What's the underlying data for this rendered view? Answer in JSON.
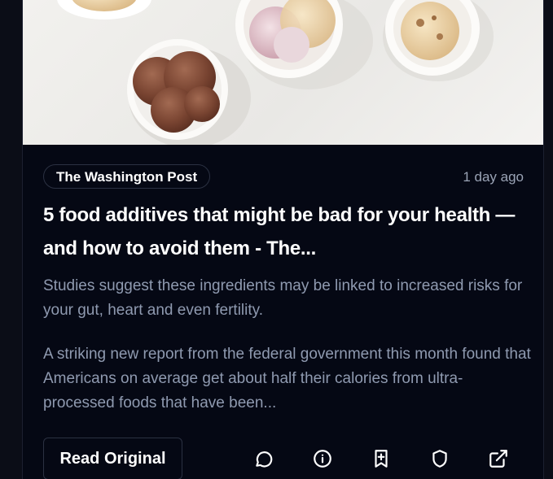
{
  "article": {
    "source": "The Washington Post",
    "time_ago": "1 day ago",
    "title": "5 food additives that might be bad for your health — and how to avoid them - The...",
    "subtitle": "Studies suggest these ingredients may be linked to increased risks for your gut, heart and even fertility.",
    "excerpt": "A striking new report from the federal government this month found that Americans on average get about half their calories from ultra-processed foods that have been..."
  },
  "actions": {
    "read_original_label": "Read Original",
    "icons": [
      "comment-icon",
      "info-icon",
      "bookmark-add-icon",
      "shield-icon",
      "external-link-icon"
    ]
  },
  "colors": {
    "card_background": "#050814",
    "text_primary": "#ffffff",
    "text_secondary": "#8f9ab0",
    "border": "#2b3142"
  }
}
